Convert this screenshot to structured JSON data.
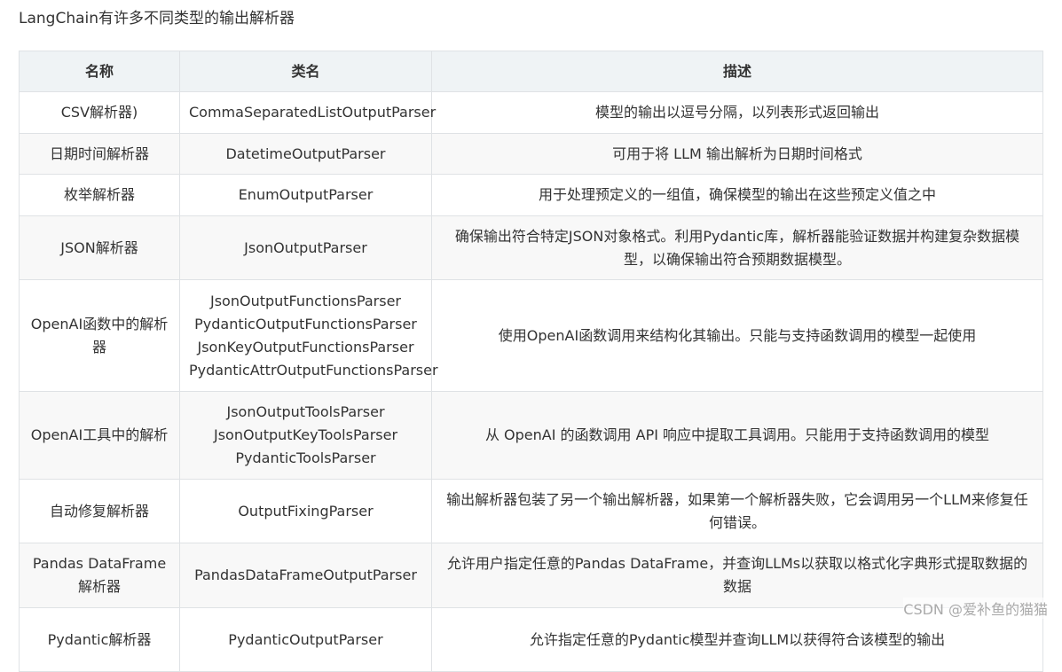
{
  "intro": "LangChain有许多不同类型的输出解析器",
  "table": {
    "headers": [
      "名称",
      "类名",
      "描述"
    ],
    "rows": [
      {
        "name": "CSV解析器)",
        "classes": [
          "CommaSeparatedListOutputParser"
        ],
        "desc": "模型的输出以逗号分隔，以列表形式返回输出"
      },
      {
        "name": "日期时间解析器",
        "classes": [
          "DatetimeOutputParser"
        ],
        "desc": "可用于将 LLM 输出解析为日期时间格式"
      },
      {
        "name": "枚举解析器",
        "classes": [
          "EnumOutputParser"
        ],
        "desc": "用于处理预定义的一组值，确保模型的输出在这些预定义值之中"
      },
      {
        "name": "JSON解析器",
        "classes": [
          "JsonOutputParser"
        ],
        "desc": "确保输出符合特定JSON对象格式。利用Pydantic库，解析器能验证数据并构建复杂数据模型，以确保输出符合预期数据模型。"
      },
      {
        "name": "OpenAI函数中的解析器",
        "classes": [
          "JsonOutputFunctionsParser",
          "PydanticOutputFunctionsParser",
          "JsonKeyOutputFunctionsParser",
          "PydanticAttrOutputFunctionsParser"
        ],
        "desc": "使用OpenAI函数调用来结构化其输出。只能与支持函数调用的模型一起使用"
      },
      {
        "name": "OpenAI工具中的解析",
        "classes": [
          "JsonOutputToolsParser",
          "JsonOutputKeyToolsParser",
          "PydanticToolsParser"
        ],
        "desc": "从 OpenAI 的函数调用 API 响应中提取工具调用。只能用于支持函数调用的模型"
      },
      {
        "name": "自动修复解析器",
        "classes": [
          "OutputFixingParser"
        ],
        "desc": "输出解析器包装了另一个输出解析器，如果第一个解析器失败，它会调用另一个LLM来修复任何错误。"
      },
      {
        "name": "Pandas DataFrame解析器",
        "classes": [
          "PandasDataFrameOutputParser"
        ],
        "desc": "允许用户指定任意的Pandas DataFrame，并查询LLMs以获取以格式化字典形式提取数据的数据"
      },
      {
        "name": "Pydantic解析器",
        "classes": [
          "PydanticOutputParser"
        ],
        "desc": "允许指定任意的Pydantic模型并查询LLM以获得符合该模型的输出"
      }
    ]
  },
  "watermark": "CSDN @爱补鱼的猫猫"
}
